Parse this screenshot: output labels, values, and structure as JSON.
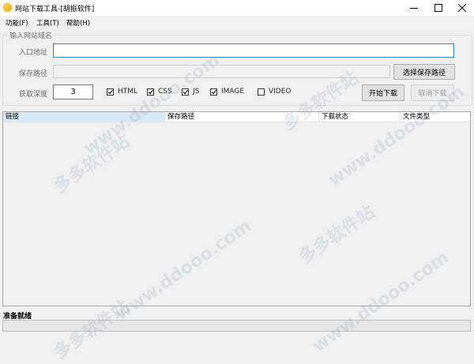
{
  "window": {
    "title": "网站下载工具-[胡振软件]"
  },
  "menu": [
    {
      "label": "功能(F)"
    },
    {
      "label": "工具(T)"
    },
    {
      "label": "帮助(H)"
    }
  ],
  "form": {
    "group_title": "输入网站域名",
    "entry_label": "入口地址",
    "entry_value": "",
    "save_path_label": "保存路径",
    "save_path_value": "",
    "choose_path_button": "选择保存路径",
    "depth_label": "获取深度",
    "depth_value": "3",
    "options": [
      {
        "label": "HTML",
        "checked": true
      },
      {
        "label": "CSS",
        "checked": true
      },
      {
        "label": "JS",
        "checked": true
      },
      {
        "label": "IMAGE",
        "checked": true
      },
      {
        "label": "VIDEO",
        "checked": false
      }
    ],
    "start_button": "开始下载",
    "cancel_button": "取消下载"
  },
  "table": {
    "columns": [
      "链接",
      "保存路径",
      "下载状态",
      "文件类型"
    ],
    "rows": []
  },
  "status": {
    "text": "准备就绪",
    "progress": 0
  },
  "watermark": [
    "多多软件站",
    "www.ddooo.com",
    "多多软件站",
    "www.ddooo.com",
    "多多软件站",
    "www.ddooo.com",
    "多多软件站",
    "www.ddooo.com"
  ]
}
